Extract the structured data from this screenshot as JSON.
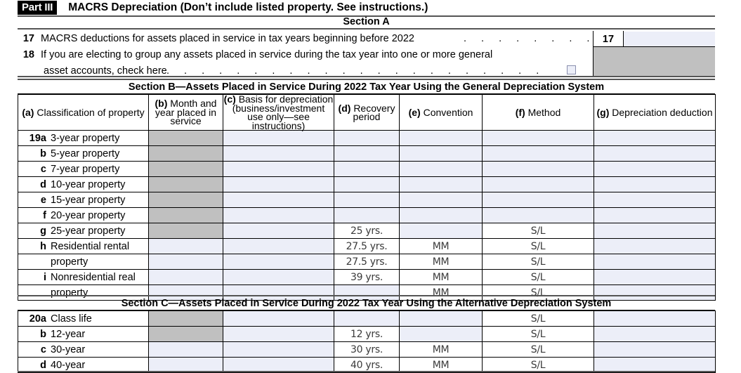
{
  "part": {
    "tag": "Part III",
    "title": "MACRS Depreciation (Don’t include listed property. See instructions.)"
  },
  "sections": {
    "a": "Section A",
    "b": "Section B—Assets Placed in Service During 2022 Tax Year Using the General Depreciation System",
    "c": "Section C—Assets Placed in Service During 2022 Tax Year Using the Alternative Depreciation System"
  },
  "lines": [
    {
      "number": "17",
      "text": "MACRS deductions for assets placed in service in tax years beginning before 2022",
      "leader": ". . . . . . . .",
      "box_label": "17",
      "value": ""
    },
    {
      "number": "18",
      "text_line1": "If you are electing to group any assets placed in service during the tax year into one or more general",
      "text_line2": "asset accounts, check here",
      "leader": ". . . . . . . . . . . . . . . . . . . . . .",
      "checkbox_checked": false
    }
  ],
  "section_b": {
    "headers": [
      {
        "tag": "(a)",
        "label": "Classification of property"
      },
      {
        "tag": "(b)",
        "label": "Month and year placed in service"
      },
      {
        "tag": "(c)",
        "label": "Basis for depreciation (business/investment use only—see instructions)"
      },
      {
        "tag": "(d)",
        "label": "Recovery period"
      },
      {
        "tag": "(e)",
        "label": "Convention"
      },
      {
        "tag": "(f)",
        "label": "Method"
      },
      {
        "tag": "(g)",
        "label": "Depreciation deduction"
      }
    ],
    "rows": [
      {
        "letter": "19a",
        "name": "3-year property",
        "b": "",
        "b_style": "gray",
        "c": "",
        "d": "",
        "e": "",
        "f": "",
        "g": ""
      },
      {
        "letter": "b",
        "name": "5-year property",
        "b": "",
        "b_style": "gray",
        "c": "",
        "d": "",
        "e": "",
        "f": "",
        "g": ""
      },
      {
        "letter": "c",
        "name": "7-year property",
        "b": "",
        "b_style": "gray",
        "c": "",
        "d": "",
        "e": "",
        "f": "",
        "g": ""
      },
      {
        "letter": "d",
        "name": "10-year property",
        "b": "",
        "b_style": "gray",
        "c": "",
        "d": "",
        "e": "",
        "f": "",
        "g": ""
      },
      {
        "letter": "e",
        "name": "15-year property",
        "b": "",
        "b_style": "gray",
        "c": "",
        "d": "",
        "e": "",
        "f": "",
        "g": ""
      },
      {
        "letter": "f",
        "name": "20-year property",
        "b": "",
        "b_style": "gray",
        "c": "",
        "d": "",
        "e": "",
        "f": "",
        "g": ""
      },
      {
        "letter": "g",
        "name": "25-year property",
        "b": "",
        "b_style": "gray",
        "c": "",
        "d": "25 yrs.",
        "e": "",
        "f": "S/L",
        "g": ""
      },
      {
        "letter": "h",
        "name": "Residential rental",
        "b": "",
        "b_style": "blue",
        "c": "",
        "d": "27.5 yrs.",
        "e": "MM",
        "f": "S/L",
        "g": ""
      },
      {
        "letter": "",
        "name": "property",
        "b": "",
        "b_style": "blue",
        "c": "",
        "d": "27.5 yrs.",
        "e": "MM",
        "f": "S/L",
        "g": ""
      },
      {
        "letter": "i",
        "name": "Nonresidential real",
        "b": "",
        "b_style": "blue",
        "c": "",
        "d": "39 yrs.",
        "e": "MM",
        "f": "S/L",
        "g": ""
      },
      {
        "letter": "",
        "name": "property",
        "b": "",
        "b_style": "blue",
        "c": "",
        "d": "",
        "e": "MM",
        "f": "S/L",
        "g": ""
      }
    ]
  },
  "section_c": {
    "rows": [
      {
        "letter": "20a",
        "name": "Class life",
        "b": "",
        "b_style": "gray",
        "c": "",
        "d": "",
        "e": "",
        "f": "S/L",
        "g": ""
      },
      {
        "letter": "b",
        "name": "12-year",
        "b": "",
        "b_style": "gray",
        "c": "",
        "d": "12 yrs.",
        "e": "",
        "f": "S/L",
        "g": ""
      },
      {
        "letter": "c",
        "name": "30-year",
        "b": "",
        "b_style": "blue",
        "c": "",
        "d": "30 yrs.",
        "e": "MM",
        "f": "S/L",
        "g": ""
      },
      {
        "letter": "d",
        "name": "40-year",
        "b": "",
        "b_style": "blue",
        "c": "",
        "d": "40 yrs.",
        "e": "MM",
        "f": "S/L",
        "g": ""
      }
    ]
  },
  "colors": {
    "input_blue": "#eceef8",
    "shaded_gray": "#c0c0c0",
    "rule": "#555555"
  }
}
